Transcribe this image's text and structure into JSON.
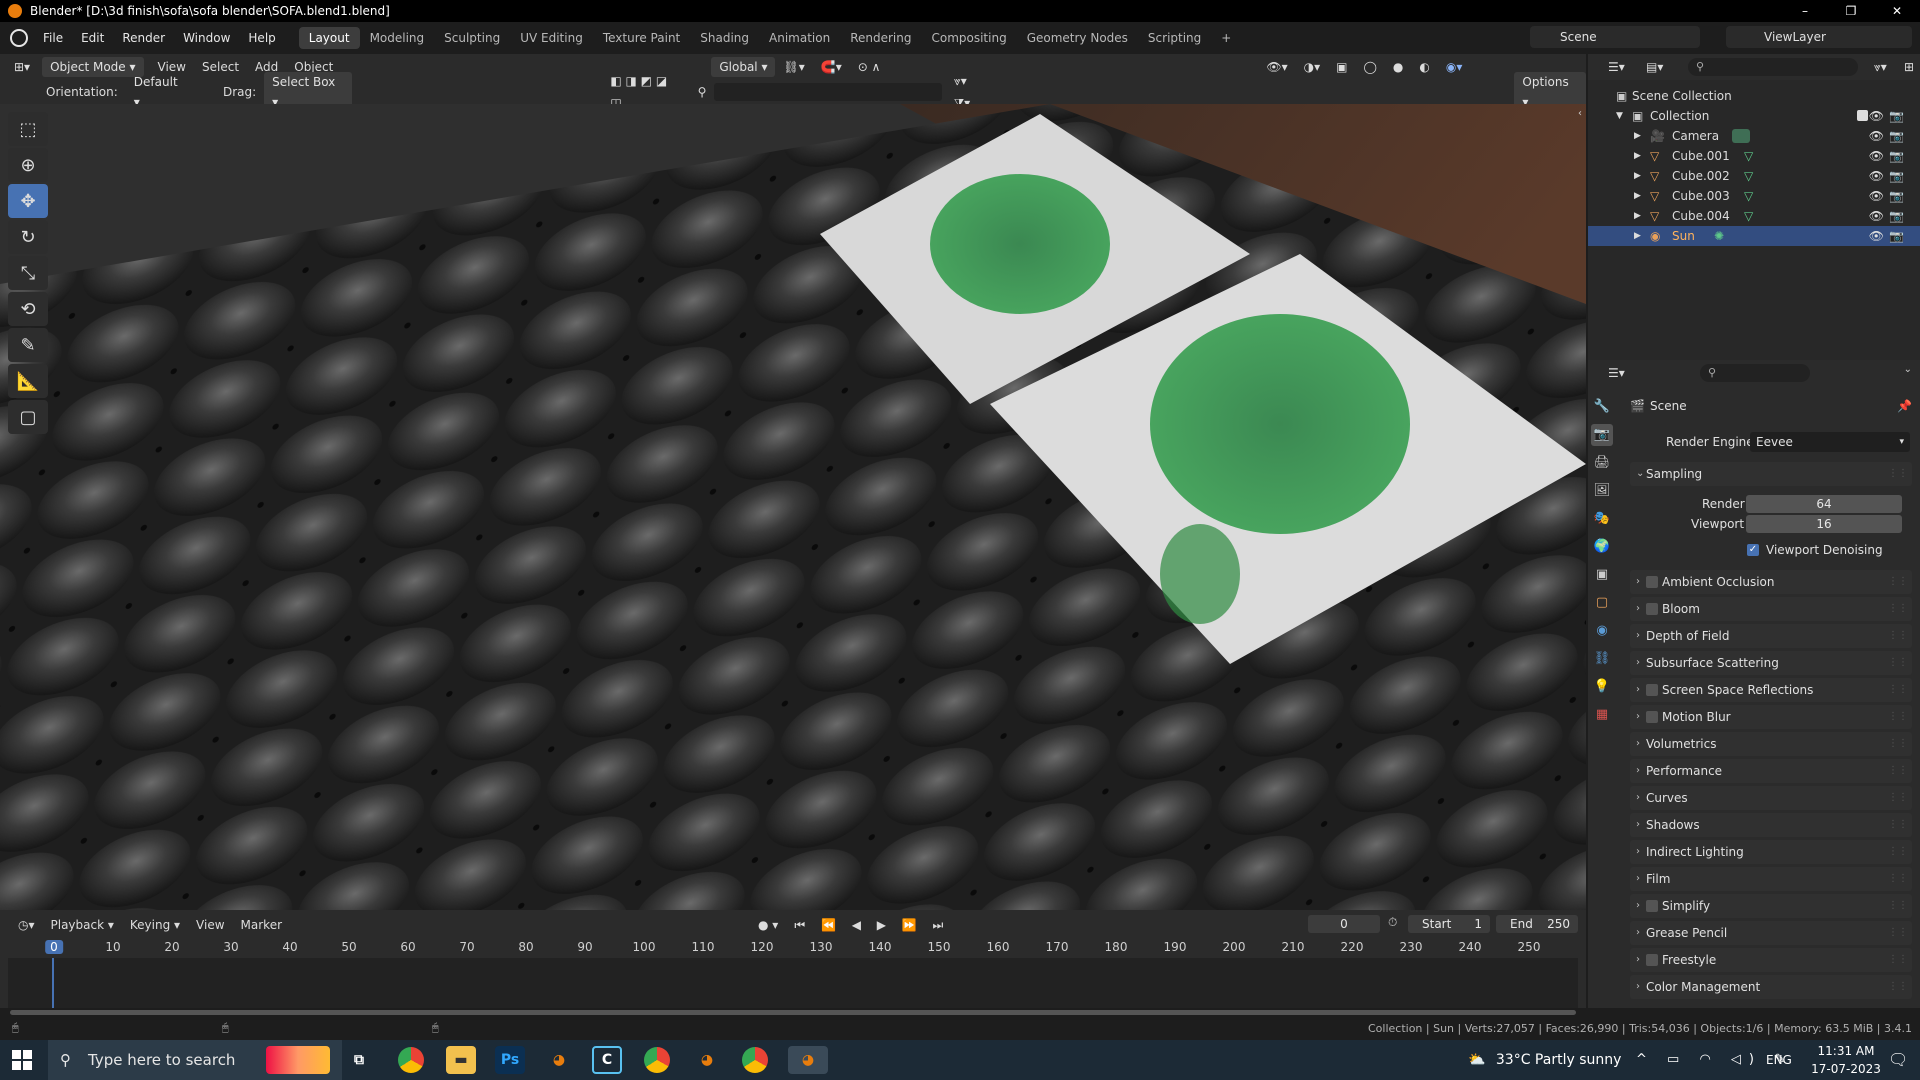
{
  "window": {
    "title": "Blender* [D:\\3d finish\\sofa\\sofa blender\\SOFA.blend1.blend]",
    "minimize": "–",
    "maximize": "❐",
    "close": "✕"
  },
  "menu": [
    "File",
    "Edit",
    "Render",
    "Window",
    "Help"
  ],
  "workspaces": [
    "Layout",
    "Modeling",
    "Sculpting",
    "UV Editing",
    "Texture Paint",
    "Shading",
    "Animation",
    "Rendering",
    "Compositing",
    "Geometry Nodes",
    "Scripting"
  ],
  "add_workspace": "+",
  "scene_selector": "Scene",
  "view_layer": "ViewLayer",
  "viewport_header": {
    "mode": "Object Mode",
    "menus": [
      "View",
      "Select",
      "Add",
      "Object"
    ],
    "transform_orientation": "Global",
    "options": "Options"
  },
  "tool_settings": {
    "orientation_label": "Orientation:",
    "orientation_value": "Default",
    "drag_label": "Drag:",
    "drag_value": "Select Box"
  },
  "outliner": {
    "root": "Scene Collection",
    "collection": "Collection",
    "items": [
      "Camera",
      "Cube.001",
      "Cube.002",
      "Cube.003",
      "Cube.004",
      "Sun"
    ],
    "selected": "Sun"
  },
  "properties": {
    "context": "Scene",
    "render_engine_label": "Render Engine",
    "render_engine_value": "Eevee",
    "sampling_title": "Sampling",
    "render_label": "Render",
    "render_value": "64",
    "viewport_label": "Viewport",
    "viewport_value": "16",
    "viewport_denoising": "Viewport Denoising",
    "panels": [
      "Ambient Occlusion",
      "Bloom",
      "Depth of Field",
      "Subsurface Scattering",
      "Screen Space Reflections",
      "Motion Blur",
      "Volumetrics",
      "Performance",
      "Curves",
      "Shadows",
      "Indirect Lighting",
      "Film",
      "Simplify",
      "Grease Pencil",
      "Freestyle",
      "Color Management"
    ],
    "panels_with_checkbox": [
      "Ambient Occlusion",
      "Bloom",
      "Screen Space Reflections",
      "Motion Blur",
      "Simplify",
      "Freestyle"
    ]
  },
  "timeline": {
    "menus": [
      "Playback",
      "Keying",
      "View",
      "Marker"
    ],
    "current_frame": "0",
    "start_label": "Start",
    "start_value": "1",
    "end_label": "End",
    "end_value": "250",
    "ticks": [
      "0",
      "10",
      "20",
      "30",
      "40",
      "50",
      "60",
      "70",
      "80",
      "90",
      "100",
      "110",
      "120",
      "130",
      "140",
      "150",
      "160",
      "170",
      "180",
      "190",
      "200",
      "210",
      "220",
      "230",
      "240",
      "250"
    ]
  },
  "status_bar": "Collection | Sun | Verts:27,057 | Faces:26,990 | Tris:54,036 | Objects:1/6 | Memory: 63.5 MiB | 3.4.1",
  "taskbar": {
    "search_placeholder": "Type here to search",
    "weather": "33°C  Partly sunny",
    "language": "ENG",
    "time": "11:31 AM",
    "date": "17-07-2023",
    "apps": [
      "Ps",
      "C"
    ]
  },
  "colors": {
    "accent": "#4772b3",
    "blender_orange": "#e87d0d",
    "selected_row": "#334d80",
    "panel_bg": "#2b2b2b"
  }
}
